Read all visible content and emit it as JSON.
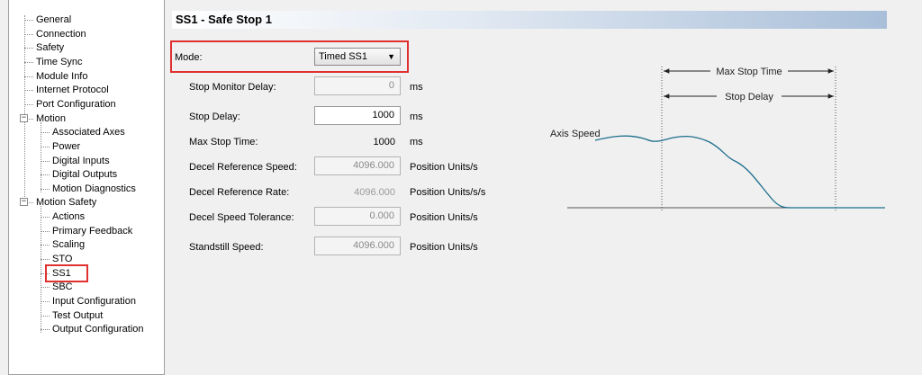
{
  "tree": {
    "items": [
      {
        "label": "General"
      },
      {
        "label": "Connection"
      },
      {
        "label": "Safety"
      },
      {
        "label": "Time Sync"
      },
      {
        "label": "Module Info"
      },
      {
        "label": "Internet Protocol"
      },
      {
        "label": "Port Configuration"
      },
      {
        "label": "Motion",
        "expander": "−"
      },
      {
        "label": "Associated Axes"
      },
      {
        "label": "Power"
      },
      {
        "label": "Digital Inputs"
      },
      {
        "label": "Digital Outputs"
      },
      {
        "label": "Motion Diagnostics"
      },
      {
        "label": "Motion Safety",
        "expander": "−"
      },
      {
        "label": "Actions"
      },
      {
        "label": "Primary Feedback"
      },
      {
        "label": "Scaling"
      },
      {
        "label": "STO"
      },
      {
        "label": "SS1"
      },
      {
        "label": "SBC"
      },
      {
        "label": "Input Configuration"
      },
      {
        "label": "Test Output"
      },
      {
        "label": "Output Configuration"
      }
    ],
    "selected": "SS1"
  },
  "section": {
    "title": "SS1 - Safe Stop 1"
  },
  "form": {
    "mode": {
      "label": "Mode:",
      "value": "Timed SS1",
      "arrow": "▼"
    },
    "stop_monitor_delay": {
      "label": "Stop Monitor Delay:",
      "value": "0",
      "unit": "ms"
    },
    "stop_delay": {
      "label": "Stop Delay:",
      "value": "1000",
      "unit": "ms"
    },
    "max_stop_time": {
      "label": "Max Stop Time:",
      "value": "1000",
      "unit": "ms"
    },
    "decel_reference_speed": {
      "label": "Decel Reference Speed:",
      "value": "4096.000",
      "unit": "Position Units/s"
    },
    "decel_reference_rate": {
      "label": "Decel Reference Rate:",
      "value": "4096.000",
      "unit": "Position Units/s/s"
    },
    "decel_speed_tolerance": {
      "label": "Decel Speed Tolerance:",
      "value": "0.000",
      "unit": "Position Units/s"
    },
    "standstill_speed": {
      "label": "Standstill Speed:",
      "value": "4096.000",
      "unit": "Position Units/s"
    }
  },
  "diagram": {
    "max_stop_time_label": "Max Stop Time",
    "stop_delay_label": "Stop Delay",
    "axis_speed_label": "Axis Speed"
  },
  "colors": {
    "highlight": "#e03030",
    "curve": "#1e6f8e"
  }
}
